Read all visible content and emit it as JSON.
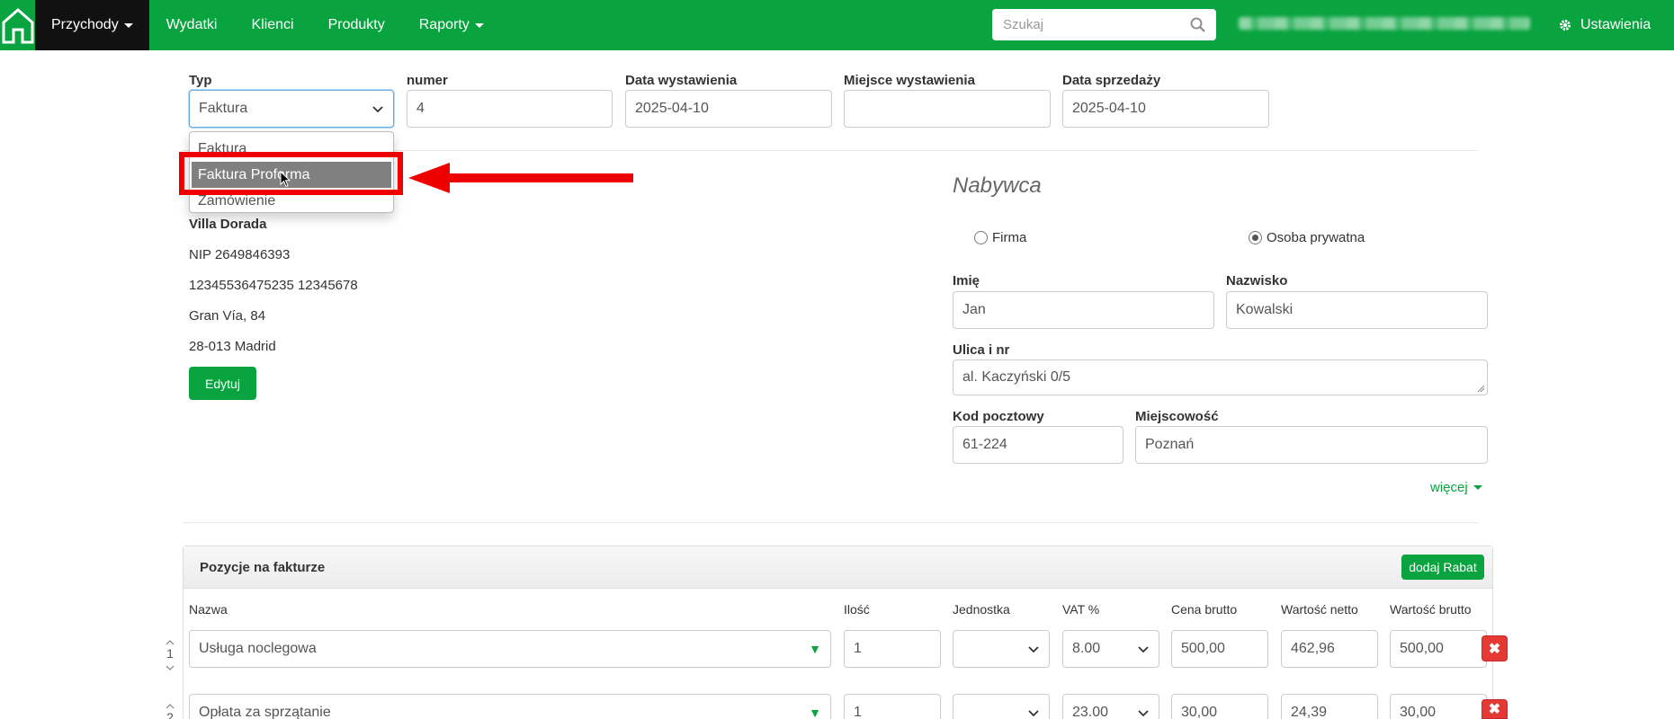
{
  "nav": {
    "items": [
      {
        "label": "Przychody",
        "dropdown": true,
        "active": true
      },
      {
        "label": "Wydatki"
      },
      {
        "label": "Klienci"
      },
      {
        "label": "Produkty"
      },
      {
        "label": "Raporty",
        "dropdown": true
      }
    ],
    "search_placeholder": "Szukaj",
    "settings_label": "Ustawienia"
  },
  "header_form": {
    "typ_label": "Typ",
    "typ_value": "Faktura",
    "numer_label": "numer",
    "numer_value": "4",
    "data_wyst_label": "Data wystawienia",
    "data_wyst_value": "2025-04-10",
    "miejsce_label": "Miejsce wystawienia",
    "miejsce_value": "",
    "data_sprz_label": "Data sprzedaży",
    "data_sprz_value": "2025-04-10"
  },
  "typ_dropdown": {
    "options": [
      "Faktura",
      "Faktura Proforma",
      "Zamówienie"
    ],
    "highlighted": "Faktura Proforma"
  },
  "seller": {
    "name": "Villa Dorada",
    "nip": "NIP 2649846393",
    "account": "12345536475235 12345678",
    "street": "Gran Vía, 84",
    "city": "28-013 Madrid",
    "edit_label": "Edytuj"
  },
  "buyer": {
    "title": "Nabywca",
    "radio_firma": "Firma",
    "radio_osoba": "Osoba prywatna",
    "selected": "Osoba prywatna",
    "imie_label": "Imię",
    "imie_value": "Jan",
    "nazwisko_label": "Nazwisko",
    "nazwisko_value": "Kowalski",
    "ulica_label": "Ulica i nr",
    "ulica_value": "al. Kaczyński 0/5",
    "kod_label": "Kod pocztowy",
    "kod_value": "61-224",
    "miejscowosc_label": "Miejscowość",
    "miejscowosc_value": "Poznań",
    "more_label": "więcej"
  },
  "positions": {
    "title": "Pozycje na fakturze",
    "add_discount_label": "dodaj Rabat",
    "columns": [
      "Nazwa",
      "Ilość",
      "Jednostka",
      "VAT %",
      "Cena brutto",
      "Wartość netto",
      "Wartość brutto"
    ],
    "rows": [
      {
        "num": "1",
        "name": "Usługa noclegowa",
        "qty": "1",
        "unit": "",
        "vat": "8.00",
        "price": "500,00",
        "net": "462,96",
        "gross": "500,00"
      },
      {
        "num": "2",
        "name": "Opłata za sprzątanie",
        "qty": "1",
        "unit": "",
        "vat": "23.00",
        "price": "30,00",
        "net": "24,39",
        "gross": "30,00"
      }
    ]
  },
  "colors": {
    "brand": "#09a33f",
    "highlight_box": "#ee0000",
    "delete": "#e53935"
  }
}
